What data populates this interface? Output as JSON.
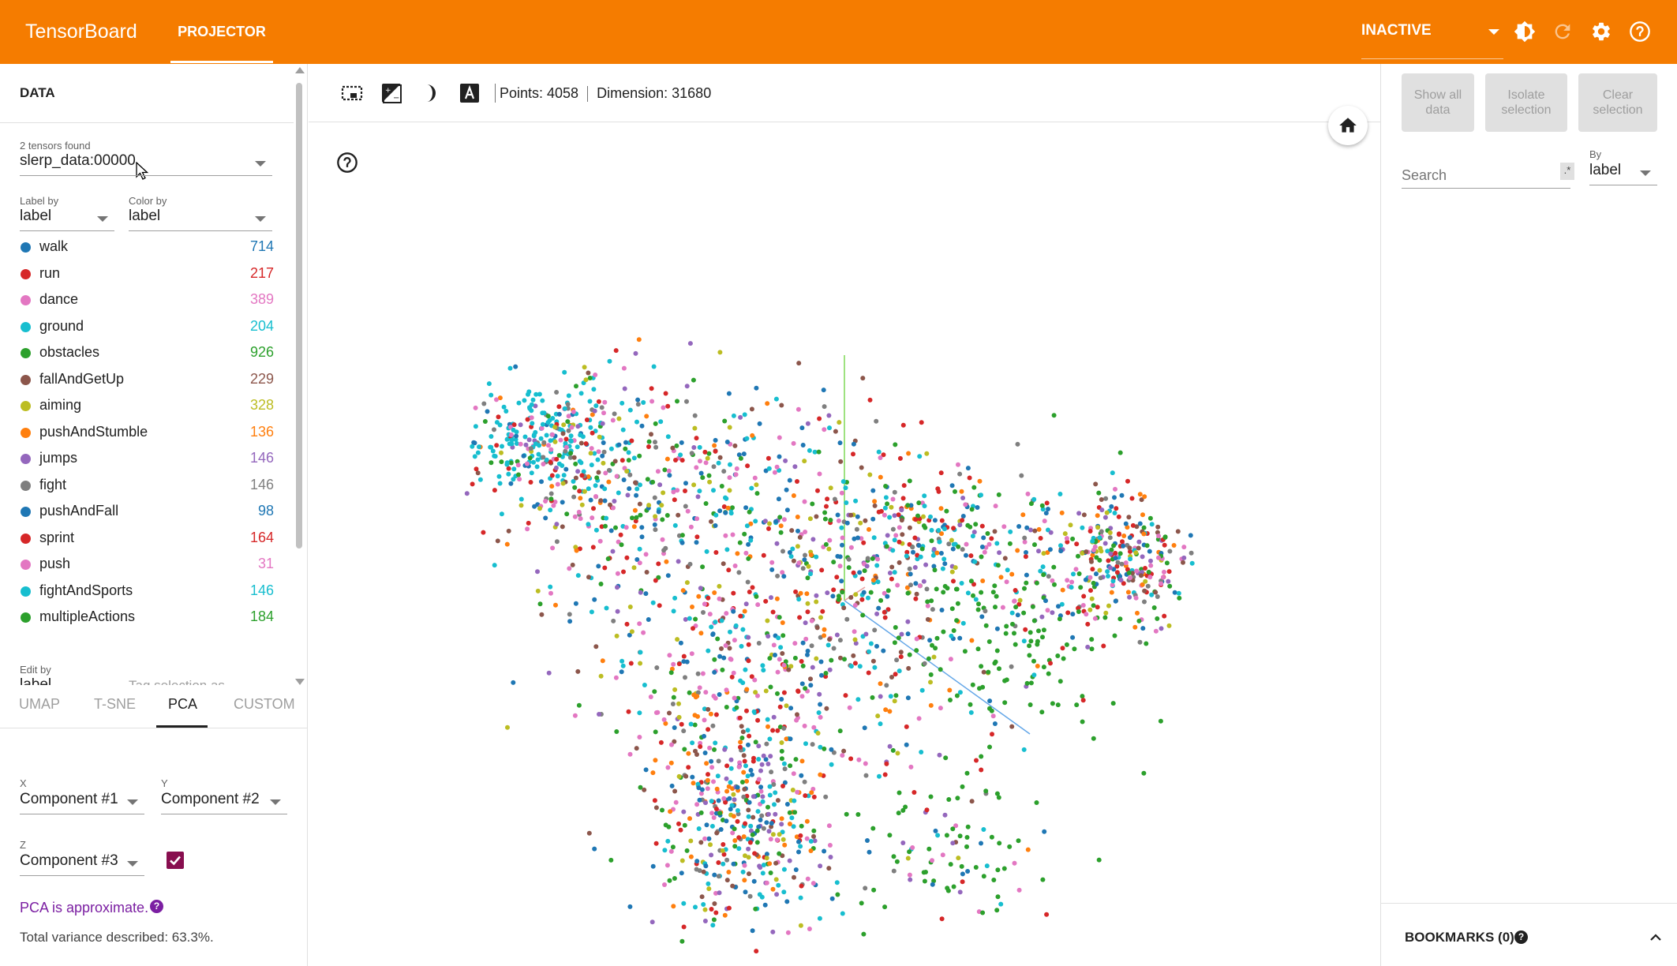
{
  "app": {
    "title": "TensorBoard",
    "active_tab": "PROJECTOR",
    "plugin_select": "INACTIVE"
  },
  "left_panel": {
    "title": "DATA",
    "tensors_found": "2 tensors found",
    "tensor": "slerp_data:00000",
    "label_by_label": "Label by",
    "label_by_value": "label",
    "color_by_label": "Color by",
    "color_by_value": "label",
    "legend": [
      {
        "name": "walk",
        "count": "714",
        "color": "#1f77b4"
      },
      {
        "name": "run",
        "count": "217",
        "color": "#d62728"
      },
      {
        "name": "dance",
        "count": "389",
        "color": "#e377c2"
      },
      {
        "name": "ground",
        "count": "204",
        "color": "#17becf"
      },
      {
        "name": "obstacles",
        "count": "926",
        "color": "#2ca02c"
      },
      {
        "name": "fallAndGetUp",
        "count": "229",
        "color": "#8c564b"
      },
      {
        "name": "aiming",
        "count": "328",
        "color": "#bcbd22"
      },
      {
        "name": "pushAndStumble",
        "count": "136",
        "color": "#ff7f0e"
      },
      {
        "name": "jumps",
        "count": "146",
        "color": "#9467bd"
      },
      {
        "name": "fight",
        "count": "146",
        "color": "#7f7f7f"
      },
      {
        "name": "pushAndFall",
        "count": "98",
        "color": "#1f77b4"
      },
      {
        "name": "sprint",
        "count": "164",
        "color": "#d62728"
      },
      {
        "name": "push",
        "count": "31",
        "color": "#e377c2"
      },
      {
        "name": "fightAndSports",
        "count": "146",
        "color": "#17becf"
      },
      {
        "name": "multipleActions",
        "count": "184",
        "color": "#2ca02c"
      }
    ],
    "edit_by_label": "Edit by",
    "edit_by_value": "label",
    "tag_selection": "Tag selection as"
  },
  "projection_tabs": [
    "UMAP",
    "T-SNE",
    "PCA",
    "CUSTOM"
  ],
  "active_projection": "PCA",
  "pca": {
    "x_label": "X",
    "x_value": "Component #1",
    "y_label": "Y",
    "y_value": "Component #2",
    "z_label": "Z",
    "z_value": "Component #3",
    "z_enabled": true,
    "approx_note": "PCA is approximate.",
    "variance": "Total variance described: 63.3%."
  },
  "toolbar": {
    "points": "Points: 4058",
    "dimension": "Dimension: 31680"
  },
  "right_panel": {
    "show_all": "Show all data",
    "isolate": "Isolate selection",
    "clear": "Clear selection",
    "search_placeholder": "Search",
    "regex_label": ".*",
    "by_label": "By",
    "by_value": "label",
    "bookmarks": "BOOKMARKS (0)"
  },
  "colors": {
    "accent": "#f57c00",
    "pca_note": "#7b1fa2",
    "checkbox": "#880e4f"
  }
}
